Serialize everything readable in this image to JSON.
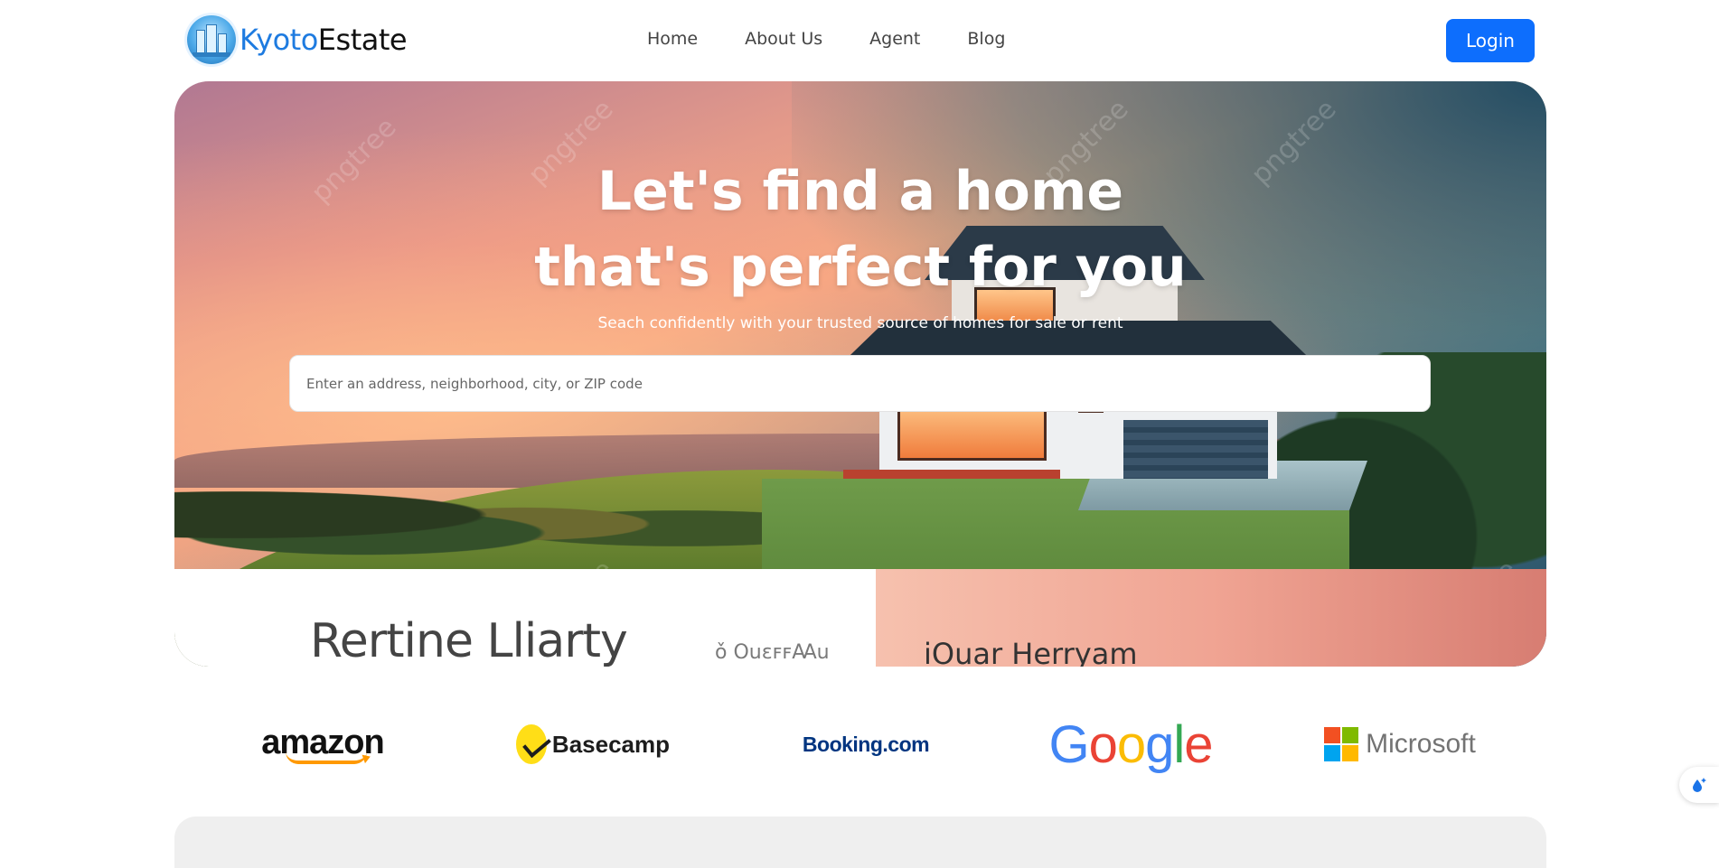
{
  "brand": {
    "name_part1": "Kyoto",
    "name_part2": "Estate"
  },
  "nav": {
    "items": [
      {
        "label": "Home"
      },
      {
        "label": "About Us"
      },
      {
        "label": "Agent"
      },
      {
        "label": "Blog"
      }
    ]
  },
  "login": {
    "label": "Login"
  },
  "hero": {
    "title_line1": "Let's find a home",
    "title_line2": "that's perfect for you",
    "subtitle": "Seach confidently with your trusted source of homes for sale or rent",
    "search_placeholder": "Enter an address, neighborhood, city, or ZIP code",
    "image_text_1": "Rertine Lliarty",
    "image_text_2": "ǒ ОuɛꜰꜰꜲu",
    "image_text_3": "iOuar Herryam",
    "watermark": "pngtree"
  },
  "partners": {
    "amazon": "amazon",
    "basecamp": "Basecamp",
    "booking": "Booking.com",
    "google": [
      "G",
      "o",
      "o",
      "g",
      "l",
      "e"
    ],
    "microsoft": "Microsoft"
  },
  "colors": {
    "primary": "#0d6efd",
    "brand_blue": "#1e7be0"
  },
  "widget": {
    "icon": "sparkle-drop-icon"
  }
}
